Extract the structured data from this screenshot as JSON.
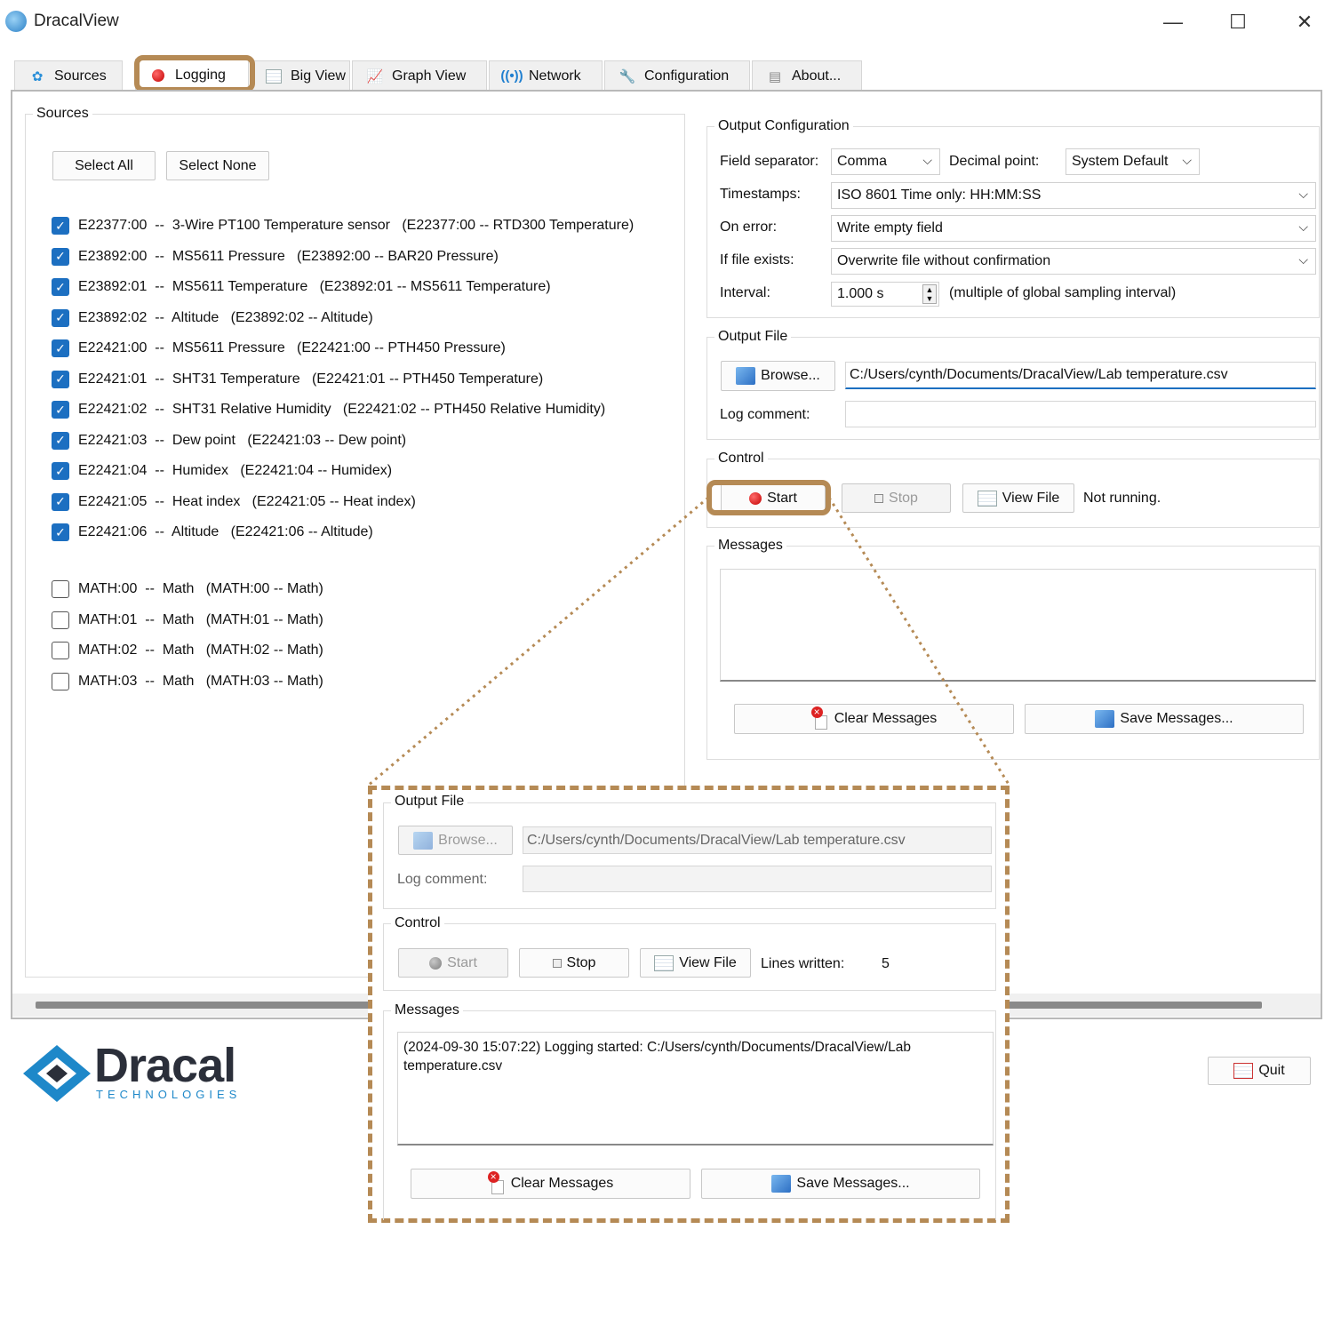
{
  "window": {
    "title": "DracalView",
    "minimize": "—",
    "maximize": "☐",
    "close": "✕"
  },
  "tabs": [
    {
      "label": "Sources",
      "icon": "sources-icon"
    },
    {
      "label": "Logging",
      "icon": "record-icon"
    },
    {
      "label": "Big View",
      "icon": "grid-icon"
    },
    {
      "label": "Graph View",
      "icon": "graph-icon"
    },
    {
      "label": "Network",
      "icon": "network-icon"
    },
    {
      "label": "Configuration",
      "icon": "wrench-icon"
    },
    {
      "label": "About...",
      "icon": "about-icon"
    }
  ],
  "sources": {
    "title": "Sources",
    "select_all": "Select All",
    "select_none": "Select None",
    "checked": [
      "E22377:00  --  3-Wire PT100 Temperature sensor   (E22377:00 -- RTD300 Temperature)",
      "E23892:00  --  MS5611 Pressure   (E23892:00 -- BAR20 Pressure)",
      "E23892:01  --  MS5611 Temperature   (E23892:01 -- MS5611 Temperature)",
      "E23892:02  --  Altitude   (E23892:02 -- Altitude)",
      "E22421:00  --  MS5611 Pressure   (E22421:00 -- PTH450 Pressure)",
      "E22421:01  --  SHT31 Temperature   (E22421:01 -- PTH450 Temperature)",
      "E22421:02  --  SHT31 Relative Humidity   (E22421:02 -- PTH450 Relative Humidity)",
      "E22421:03  --  Dew point   (E22421:03 -- Dew point)",
      "E22421:04  --  Humidex   (E22421:04 -- Humidex)",
      "E22421:05  --  Heat index   (E22421:05 -- Heat index)",
      "E22421:06  --  Altitude   (E22421:06 -- Altitude)"
    ],
    "unchecked": [
      "MATH:00  --  Math   (MATH:00 -- Math)",
      "MATH:01  --  Math   (MATH:01 -- Math)",
      "MATH:02  --  Math   (MATH:02 -- Math)",
      "MATH:03  --  Math   (MATH:03 -- Math)"
    ]
  },
  "output_config": {
    "title": "Output Configuration",
    "field_separator_label": "Field separator:",
    "field_separator_value": "Comma",
    "decimal_point_label": "Decimal point:",
    "decimal_point_value": "System Default",
    "timestamps_label": "Timestamps:",
    "timestamps_value": "ISO 8601 Time only: HH:MM:SS",
    "on_error_label": "On error:",
    "on_error_value": "Write empty field",
    "if_exists_label": "If file exists:",
    "if_exists_value": "Overwrite file without confirmation",
    "interval_label": "Interval:",
    "interval_value": "1.000 s",
    "interval_hint": "(multiple of global sampling interval)"
  },
  "output_file": {
    "title": "Output File",
    "browse": "Browse...",
    "path": "C:/Users/cynth/Documents/DracalView/Lab temperature.csv",
    "log_comment_label": "Log comment:",
    "log_comment_value": ""
  },
  "control": {
    "title": "Control",
    "start": "Start",
    "stop": "Stop",
    "view_file": "View File",
    "status": "Not running."
  },
  "messages": {
    "title": "Messages",
    "text": "",
    "clear": "Clear Messages",
    "save": "Save Messages..."
  },
  "footer": {
    "logo_word": "Dracal",
    "logo_sub": "TECHNOLOGIES",
    "quit": "Quit"
  },
  "zoom": {
    "output_file_title": "Output File",
    "browse": "Browse...",
    "path": "C:/Users/cynth/Documents/DracalView/Lab temperature.csv",
    "log_comment_label": "Log comment:",
    "control_title": "Control",
    "start": "Start",
    "stop": "Stop",
    "view_file": "View File",
    "lines_label": "Lines written:",
    "lines_value": "5",
    "messages_title": "Messages",
    "message_text": "(2024-09-30 15:07:22)  Logging started: C:/Users/cynth/Documents/DracalView/Lab temperature.csv",
    "clear": "Clear Messages",
    "save": "Save Messages..."
  },
  "colors": {
    "highlight": "#b58a55",
    "check_blue": "#1c6fc1",
    "logo_blue": "#1e88c9",
    "logo_dark": "#2b2f3a"
  }
}
